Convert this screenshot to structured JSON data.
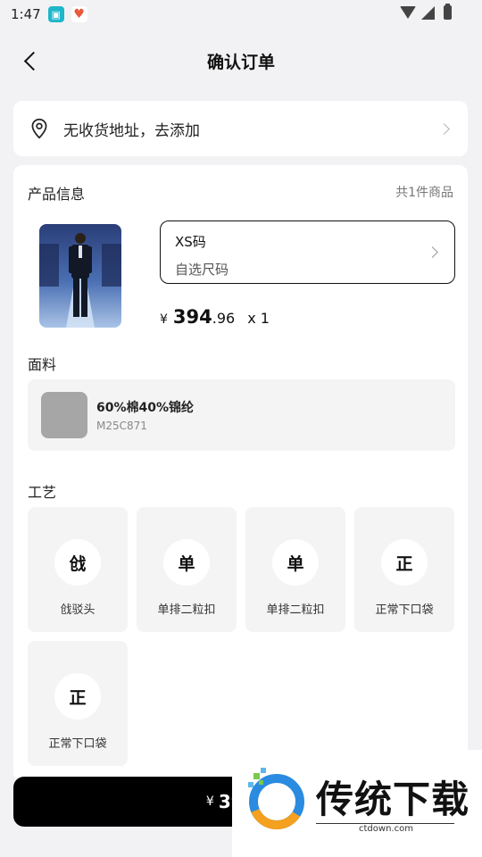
{
  "status_bar": {
    "time": "1:47"
  },
  "header": {
    "title": "确认订单"
  },
  "address": {
    "text": "无收货地址，去添加"
  },
  "product": {
    "section_title": "产品信息",
    "count": "共1件商品",
    "size_value": "XS码",
    "size_hint": "自选尺码",
    "currency": "¥",
    "price_int": "394",
    "price_dec": ".96",
    "quantity": "x 1"
  },
  "fabric": {
    "section_title": "面料",
    "name": "60%棉40%锦纶",
    "code": "M25C871",
    "swatch_color": "#a6a6a6"
  },
  "craft": {
    "section_title": "工艺",
    "items": [
      {
        "glyph": "戗",
        "label": "戗驳头"
      },
      {
        "glyph": "单",
        "label": "单排二粒扣"
      },
      {
        "glyph": "单",
        "label": "单排二粒扣"
      },
      {
        "glyph": "正",
        "label": "正常下口袋"
      },
      {
        "glyph": "正",
        "label": "正常下口袋"
      }
    ]
  },
  "checkout": {
    "currency": "¥",
    "price": "394.9"
  },
  "watermark": {
    "text": "传统下载",
    "url": "ctdown.com"
  }
}
